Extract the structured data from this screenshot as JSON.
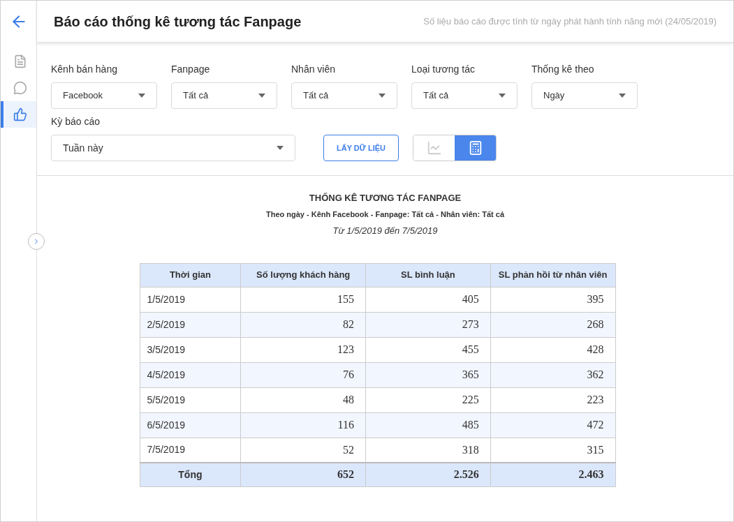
{
  "sidebar": {
    "items": [
      {
        "kind": "document",
        "selected": false
      },
      {
        "kind": "messenger",
        "selected": false
      },
      {
        "kind": "like",
        "selected": true
      }
    ]
  },
  "header": {
    "title": "Báo cáo thống kê tương tác Fanpage",
    "note": "Số liệu báo cáo được tính từ ngày phát hành tính năng mới (24/05/2019)"
  },
  "filters": [
    {
      "label": "Kênh bán hàng",
      "value": "Facebook"
    },
    {
      "label": "Fanpage",
      "value": "Tất cả"
    },
    {
      "label": "Nhân viên",
      "value": "Tất cả"
    },
    {
      "label": "Loại tương tác",
      "value": "Tất cả"
    },
    {
      "label": "Thống kê theo",
      "value": "Ngày"
    }
  ],
  "period": {
    "label": "Kỳ báo cáo",
    "value": "Tuần này"
  },
  "fetch_button": "LẤY DỮ LIỆU",
  "view_toggle": [
    {
      "kind": "chart",
      "selected": false
    },
    {
      "kind": "table",
      "selected": true
    }
  ],
  "report": {
    "title": "THỐNG KÊ TƯƠNG TÁC FANPAGE",
    "subtitle": "Theo ngày - Kênh Facebook - Fanpage: Tất cả - Nhân viên: Tất cả",
    "range": "Từ 1/5/2019 đến 7/5/2019"
  },
  "table": {
    "columns": [
      "Thời gian",
      "Số lượng khách hàng",
      "SL bình luận",
      "SL phản hồi từ nhân viên"
    ],
    "rows": [
      [
        "1/5/2019",
        "155",
        "405",
        "395"
      ],
      [
        "2/5/2019",
        "82",
        "273",
        "268"
      ],
      [
        "3/5/2019",
        "123",
        "455",
        "428"
      ],
      [
        "4/5/2019",
        "76",
        "365",
        "362"
      ],
      [
        "5/5/2019",
        "48",
        "225",
        "223"
      ],
      [
        "6/5/2019",
        "116",
        "485",
        "472"
      ],
      [
        "7/5/2019",
        "52",
        "318",
        "315"
      ]
    ],
    "total": [
      "Tổng",
      "652",
      "2.526",
      "2.463"
    ]
  }
}
